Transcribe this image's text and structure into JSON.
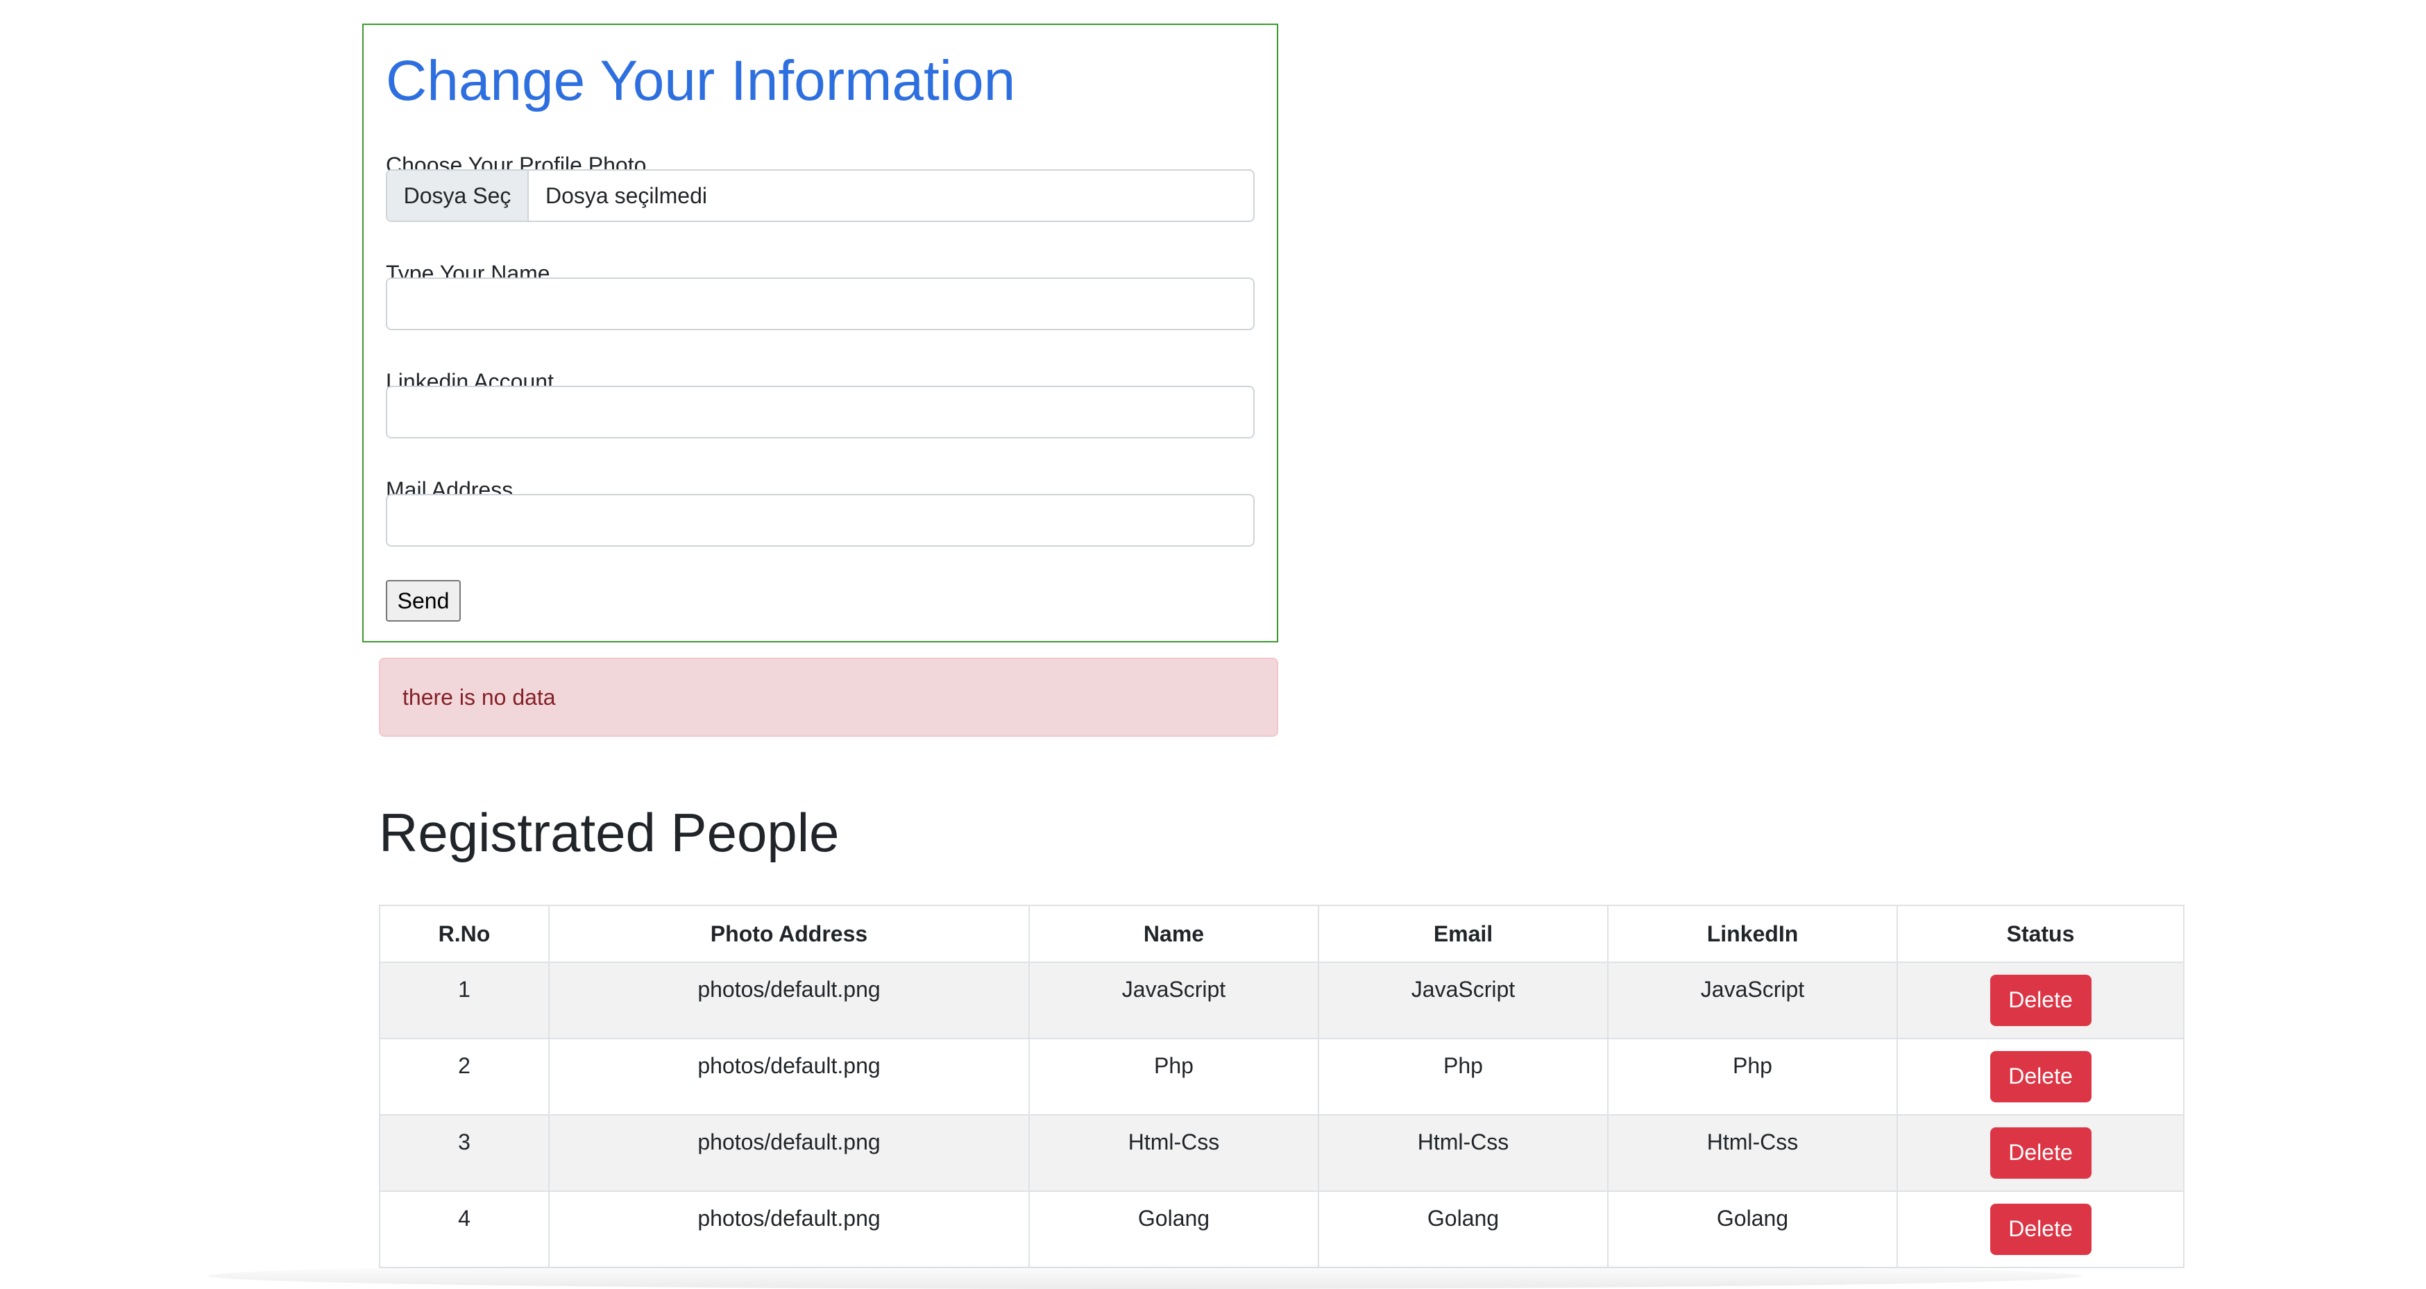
{
  "form": {
    "title": "Change Your Information",
    "photo_label": "Choose Your Profile Photo",
    "file_button_label": "Dosya Seç",
    "file_status": "Dosya seçilmedi",
    "name_label": "Type Your Name",
    "name_value": "",
    "linkedin_label": "Linkedin Account",
    "linkedin_value": "",
    "mail_label": "Mail Address",
    "mail_value": "",
    "send_label": "Send"
  },
  "alert": {
    "message": "there is no data",
    "color": "#842029",
    "background": "#f2d7da"
  },
  "people": {
    "title": "Registrated People",
    "columns": [
      "R.No",
      "Photo Address",
      "Name",
      "Email",
      "LinkedIn",
      "Status"
    ],
    "rows": [
      {
        "no": "1",
        "photo": "photos/default.png",
        "name": "JavaScript",
        "email": "JavaScript",
        "linkedin": "JavaScript",
        "action": "Delete"
      },
      {
        "no": "2",
        "photo": "photos/default.png",
        "name": "Php",
        "email": "Php",
        "linkedin": "Php",
        "action": "Delete"
      },
      {
        "no": "3",
        "photo": "photos/default.png",
        "name": "Html-Css",
        "email": "Html-Css",
        "linkedin": "Html-Css",
        "action": "Delete"
      },
      {
        "no": "4",
        "photo": "photos/default.png",
        "name": "Golang",
        "email": "Golang",
        "linkedin": "Golang",
        "action": "Delete"
      }
    ]
  },
  "colors": {
    "title_blue": "#2e6fe0",
    "card_border": "#3c9a2e",
    "delete_red": "#dc3545"
  }
}
